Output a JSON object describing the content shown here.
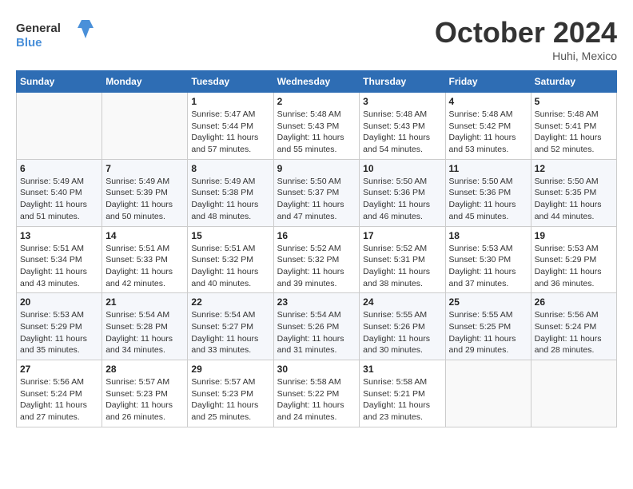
{
  "header": {
    "logo_text_general": "General",
    "logo_text_blue": "Blue",
    "month": "October 2024",
    "location": "Huhi, Mexico"
  },
  "weekdays": [
    "Sunday",
    "Monday",
    "Tuesday",
    "Wednesday",
    "Thursday",
    "Friday",
    "Saturday"
  ],
  "weeks": [
    [
      {
        "day": "",
        "sunrise": "",
        "sunset": "",
        "daylight": ""
      },
      {
        "day": "",
        "sunrise": "",
        "sunset": "",
        "daylight": ""
      },
      {
        "day": "1",
        "sunrise": "Sunrise: 5:47 AM",
        "sunset": "Sunset: 5:44 PM",
        "daylight": "Daylight: 11 hours and 57 minutes."
      },
      {
        "day": "2",
        "sunrise": "Sunrise: 5:48 AM",
        "sunset": "Sunset: 5:43 PM",
        "daylight": "Daylight: 11 hours and 55 minutes."
      },
      {
        "day": "3",
        "sunrise": "Sunrise: 5:48 AM",
        "sunset": "Sunset: 5:43 PM",
        "daylight": "Daylight: 11 hours and 54 minutes."
      },
      {
        "day": "4",
        "sunrise": "Sunrise: 5:48 AM",
        "sunset": "Sunset: 5:42 PM",
        "daylight": "Daylight: 11 hours and 53 minutes."
      },
      {
        "day": "5",
        "sunrise": "Sunrise: 5:48 AM",
        "sunset": "Sunset: 5:41 PM",
        "daylight": "Daylight: 11 hours and 52 minutes."
      }
    ],
    [
      {
        "day": "6",
        "sunrise": "Sunrise: 5:49 AM",
        "sunset": "Sunset: 5:40 PM",
        "daylight": "Daylight: 11 hours and 51 minutes."
      },
      {
        "day": "7",
        "sunrise": "Sunrise: 5:49 AM",
        "sunset": "Sunset: 5:39 PM",
        "daylight": "Daylight: 11 hours and 50 minutes."
      },
      {
        "day": "8",
        "sunrise": "Sunrise: 5:49 AM",
        "sunset": "Sunset: 5:38 PM",
        "daylight": "Daylight: 11 hours and 48 minutes."
      },
      {
        "day": "9",
        "sunrise": "Sunrise: 5:50 AM",
        "sunset": "Sunset: 5:37 PM",
        "daylight": "Daylight: 11 hours and 47 minutes."
      },
      {
        "day": "10",
        "sunrise": "Sunrise: 5:50 AM",
        "sunset": "Sunset: 5:36 PM",
        "daylight": "Daylight: 11 hours and 46 minutes."
      },
      {
        "day": "11",
        "sunrise": "Sunrise: 5:50 AM",
        "sunset": "Sunset: 5:36 PM",
        "daylight": "Daylight: 11 hours and 45 minutes."
      },
      {
        "day": "12",
        "sunrise": "Sunrise: 5:50 AM",
        "sunset": "Sunset: 5:35 PM",
        "daylight": "Daylight: 11 hours and 44 minutes."
      }
    ],
    [
      {
        "day": "13",
        "sunrise": "Sunrise: 5:51 AM",
        "sunset": "Sunset: 5:34 PM",
        "daylight": "Daylight: 11 hours and 43 minutes."
      },
      {
        "day": "14",
        "sunrise": "Sunrise: 5:51 AM",
        "sunset": "Sunset: 5:33 PM",
        "daylight": "Daylight: 11 hours and 42 minutes."
      },
      {
        "day": "15",
        "sunrise": "Sunrise: 5:51 AM",
        "sunset": "Sunset: 5:32 PM",
        "daylight": "Daylight: 11 hours and 40 minutes."
      },
      {
        "day": "16",
        "sunrise": "Sunrise: 5:52 AM",
        "sunset": "Sunset: 5:32 PM",
        "daylight": "Daylight: 11 hours and 39 minutes."
      },
      {
        "day": "17",
        "sunrise": "Sunrise: 5:52 AM",
        "sunset": "Sunset: 5:31 PM",
        "daylight": "Daylight: 11 hours and 38 minutes."
      },
      {
        "day": "18",
        "sunrise": "Sunrise: 5:53 AM",
        "sunset": "Sunset: 5:30 PM",
        "daylight": "Daylight: 11 hours and 37 minutes."
      },
      {
        "day": "19",
        "sunrise": "Sunrise: 5:53 AM",
        "sunset": "Sunset: 5:29 PM",
        "daylight": "Daylight: 11 hours and 36 minutes."
      }
    ],
    [
      {
        "day": "20",
        "sunrise": "Sunrise: 5:53 AM",
        "sunset": "Sunset: 5:29 PM",
        "daylight": "Daylight: 11 hours and 35 minutes."
      },
      {
        "day": "21",
        "sunrise": "Sunrise: 5:54 AM",
        "sunset": "Sunset: 5:28 PM",
        "daylight": "Daylight: 11 hours and 34 minutes."
      },
      {
        "day": "22",
        "sunrise": "Sunrise: 5:54 AM",
        "sunset": "Sunset: 5:27 PM",
        "daylight": "Daylight: 11 hours and 33 minutes."
      },
      {
        "day": "23",
        "sunrise": "Sunrise: 5:54 AM",
        "sunset": "Sunset: 5:26 PM",
        "daylight": "Daylight: 11 hours and 31 minutes."
      },
      {
        "day": "24",
        "sunrise": "Sunrise: 5:55 AM",
        "sunset": "Sunset: 5:26 PM",
        "daylight": "Daylight: 11 hours and 30 minutes."
      },
      {
        "day": "25",
        "sunrise": "Sunrise: 5:55 AM",
        "sunset": "Sunset: 5:25 PM",
        "daylight": "Daylight: 11 hours and 29 minutes."
      },
      {
        "day": "26",
        "sunrise": "Sunrise: 5:56 AM",
        "sunset": "Sunset: 5:24 PM",
        "daylight": "Daylight: 11 hours and 28 minutes."
      }
    ],
    [
      {
        "day": "27",
        "sunrise": "Sunrise: 5:56 AM",
        "sunset": "Sunset: 5:24 PM",
        "daylight": "Daylight: 11 hours and 27 minutes."
      },
      {
        "day": "28",
        "sunrise": "Sunrise: 5:57 AM",
        "sunset": "Sunset: 5:23 PM",
        "daylight": "Daylight: 11 hours and 26 minutes."
      },
      {
        "day": "29",
        "sunrise": "Sunrise: 5:57 AM",
        "sunset": "Sunset: 5:23 PM",
        "daylight": "Daylight: 11 hours and 25 minutes."
      },
      {
        "day": "30",
        "sunrise": "Sunrise: 5:58 AM",
        "sunset": "Sunset: 5:22 PM",
        "daylight": "Daylight: 11 hours and 24 minutes."
      },
      {
        "day": "31",
        "sunrise": "Sunrise: 5:58 AM",
        "sunset": "Sunset: 5:21 PM",
        "daylight": "Daylight: 11 hours and 23 minutes."
      },
      {
        "day": "",
        "sunrise": "",
        "sunset": "",
        "daylight": ""
      },
      {
        "day": "",
        "sunrise": "",
        "sunset": "",
        "daylight": ""
      }
    ]
  ]
}
